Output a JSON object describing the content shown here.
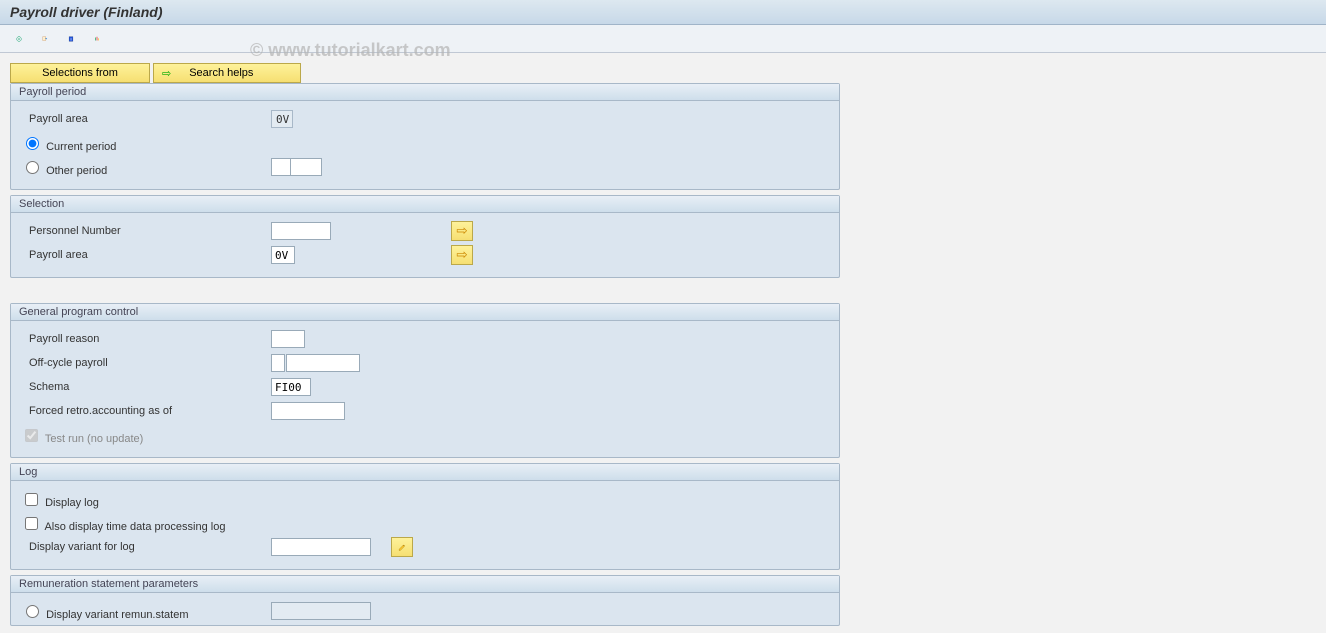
{
  "title": "Payroll driver (Finland)",
  "watermark": "© www.tutorialkart.com",
  "buttons": {
    "selections_from": "Selections from",
    "search_helps": "Search helps"
  },
  "groups": {
    "payroll_period": {
      "title": "Payroll period",
      "payroll_area_label": "Payroll area",
      "payroll_area_value": "0V",
      "radio_current": "Current period",
      "radio_other": "Other period",
      "other_val1": "",
      "other_val2": ""
    },
    "selection": {
      "title": "Selection",
      "personnel_number_label": "Personnel Number",
      "personnel_number_value": "",
      "payroll_area_label": "Payroll area",
      "payroll_area_value": "0V"
    },
    "general": {
      "title": "General program control",
      "payroll_reason_label": "Payroll reason",
      "payroll_reason_value": "",
      "offcycle_label": "Off-cycle payroll",
      "offcycle_val1": "",
      "offcycle_val2": "",
      "schema_label": "Schema",
      "schema_value": "FI00",
      "forced_retro_label": "Forced retro.accounting as of",
      "forced_retro_value": "",
      "test_run_label": "Test run (no update)"
    },
    "log": {
      "title": "Log",
      "display_log_label": "Display log",
      "also_display_label": "Also display time data processing log",
      "display_variant_label": "Display variant for log",
      "display_variant_value": ""
    },
    "remun": {
      "title": "Remuneration statement parameters",
      "display_variant_label": "Display variant remun.statem",
      "display_variant_value": ""
    }
  },
  "icons": {
    "arrow_right": "➡"
  }
}
